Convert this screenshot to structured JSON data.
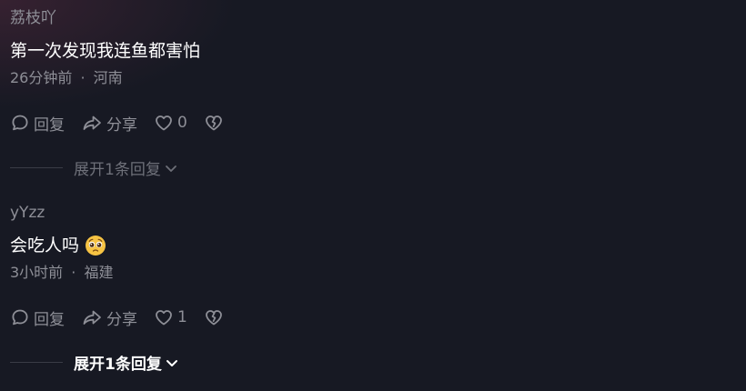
{
  "comments": [
    {
      "username": "荔枝吖",
      "text": "第一次发现我连鱼都害怕",
      "time": "26分钟前",
      "location": "河南",
      "reply_label": "回复",
      "share_label": "分享",
      "like_count": "0",
      "expand_label": "展开1条回复"
    },
    {
      "username": "yYzz",
      "text": "会吃人吗",
      "emoji": "pleading-face-emoji",
      "time": "3小时前",
      "location": "福建",
      "reply_label": "回复",
      "share_label": "分享",
      "like_count": "1",
      "expand_label": "展开1条回复"
    }
  ],
  "meta_separator": "·",
  "colors": {
    "background": "#171923",
    "primary_text": "#ffffff",
    "secondary_text": "#8e8f97",
    "muted_expand": "#6e7079"
  }
}
